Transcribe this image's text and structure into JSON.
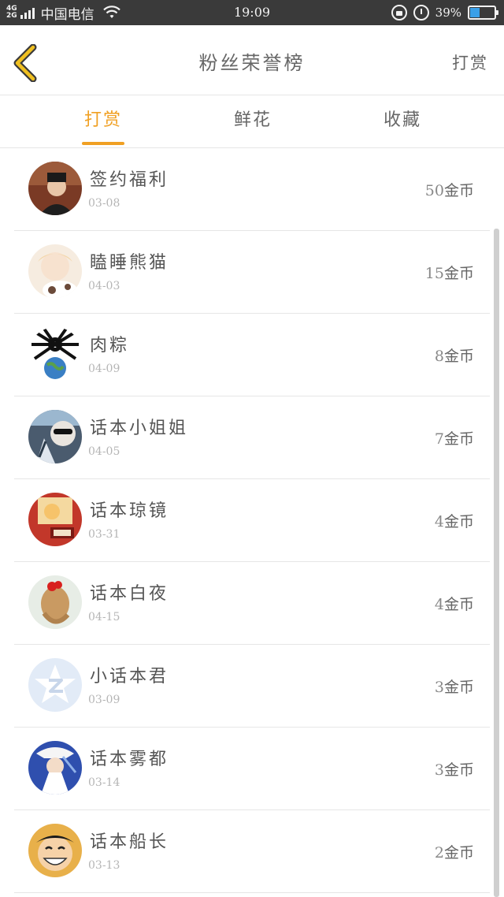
{
  "status_bar": {
    "network_top": "4G",
    "network_bottom": "2G",
    "carrier": "中国电信",
    "time": "19:09",
    "battery_percent": "39%",
    "battery_level": 0.39,
    "icons": [
      "signal-icon",
      "wifi-icon",
      "rotation-lock-icon",
      "alarm-icon",
      "battery-icon"
    ]
  },
  "header": {
    "title": "粉丝荣誉榜",
    "action_label": "打赏",
    "back_icon": "chevron-left-icon",
    "back_color": "#f0c020"
  },
  "tabs": [
    {
      "label": "打赏",
      "active": true
    },
    {
      "label": "鲜花",
      "active": false
    },
    {
      "label": "收藏",
      "active": false
    }
  ],
  "accent_color": "#f0a023",
  "list": [
    {
      "name": "签约福利",
      "date": "03-08",
      "amount": "50",
      "unit": "金币",
      "avatar": "avatar-portrait"
    },
    {
      "name": "瞌睡熊猫",
      "date": "04-03",
      "amount": "15",
      "unit": "金币",
      "avatar": "avatar-anime-girl"
    },
    {
      "name": "肉粽",
      "date": "04-09",
      "amount": "8",
      "unit": "金币",
      "avatar": "avatar-spider-globe"
    },
    {
      "name": "话本小姐姐",
      "date": "04-05",
      "amount": "7",
      "unit": "金币",
      "avatar": "avatar-sunglasses"
    },
    {
      "name": "话本琼镜",
      "date": "03-31",
      "amount": "4",
      "unit": "金币",
      "avatar": "avatar-cartoon-red"
    },
    {
      "name": "话本白夜",
      "date": "04-15",
      "amount": "4",
      "unit": "金币",
      "avatar": "avatar-hair-bow"
    },
    {
      "name": "小话本君",
      "date": "03-09",
      "amount": "3",
      "unit": "金币",
      "avatar": "avatar-default-star"
    },
    {
      "name": "话本雾都",
      "date": "03-14",
      "amount": "3",
      "unit": "金币",
      "avatar": "avatar-anime-blue"
    },
    {
      "name": "话本船长",
      "date": "03-13",
      "amount": "2",
      "unit": "金币",
      "avatar": "avatar-luffy"
    }
  ]
}
